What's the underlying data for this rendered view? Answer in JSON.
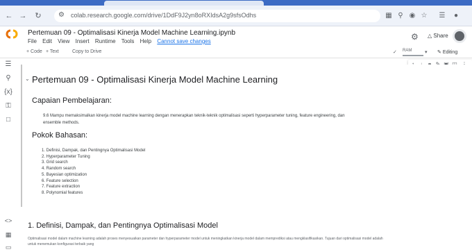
{
  "browser": {
    "url": "colab.research.google.com/drive/1DdF9J2yn8oRXIdsA2g9sfsOdhs",
    "controls": {
      "back": "←",
      "forward": "→",
      "reload": "↻"
    }
  },
  "colab": {
    "notebook_title": "Pertemuan 09 - Optimalisasi Kinerja Model Machine Learning.ipynb",
    "menus": [
      "File",
      "Edit",
      "View",
      "Insert",
      "Runtime",
      "Tools",
      "Help"
    ],
    "save_status": "Cannot save changes",
    "share_label": "Share",
    "toolbar": {
      "code_label": "+ Code",
      "text_label": "+ Text",
      "copy_label": "Copy to Drive",
      "ram_label": "RAM",
      "editing_label": "Editing"
    }
  },
  "content": {
    "heading": "Pertemuan 09 - Optimalisasi Kinerja Model Machine Learning",
    "cpl_title": "Capaian Pembelajaran:",
    "cpl_text": "9.6 Mampu memaksimalkan kinerja model machine learning dengan menerapkan teknik-teknik optimalisasi seperti hyperparameter tuning, feature engineering, dan ensemble methods.",
    "pokok_title": "Pokok Bahasan:",
    "topics": [
      "1. Definisi, Dampak, dan Pentingnya Optimalisasi Model",
      "2. Hyperparameter Tuning",
      "3. Grid search",
      "4. Random search",
      "5. Bayesian optimization",
      "6. Feature selection",
      "7. Feature extraction",
      "8. Polynomial features"
    ],
    "section1_title": "1. Definisi, Dampak, dan Pentingnya Optimalisasi Model",
    "section1_text": "Optimalisasi model dalam machine learning adalah proses menyesuaikan parameter dan hyperparameter model untuk meningkatkan kinerja model dalam memprediksi atau mengklasifikasikan. Tujuan dari optimalisasi model adalah untuk menemukan konfigurasi terbaik yang"
  },
  "icons": {
    "sidebar": [
      "menu-icon",
      "search-icon",
      "variables-icon",
      "key-icon",
      "folder-icon"
    ],
    "bottom": [
      "code-snippets-icon",
      "terminal-icon",
      "command-palette-icon"
    ],
    "cell_toolbar": [
      "arrow-up-icon",
      "arrow-down-icon",
      "link-icon",
      "edit-icon",
      "mirror-icon",
      "delete-icon",
      "more-icon"
    ]
  },
  "colors": {
    "accent": "#1a73e8",
    "chrome": "#3c6bc4",
    "logo_orange": "#f9ab00",
    "logo_amber": "#e8710a"
  }
}
